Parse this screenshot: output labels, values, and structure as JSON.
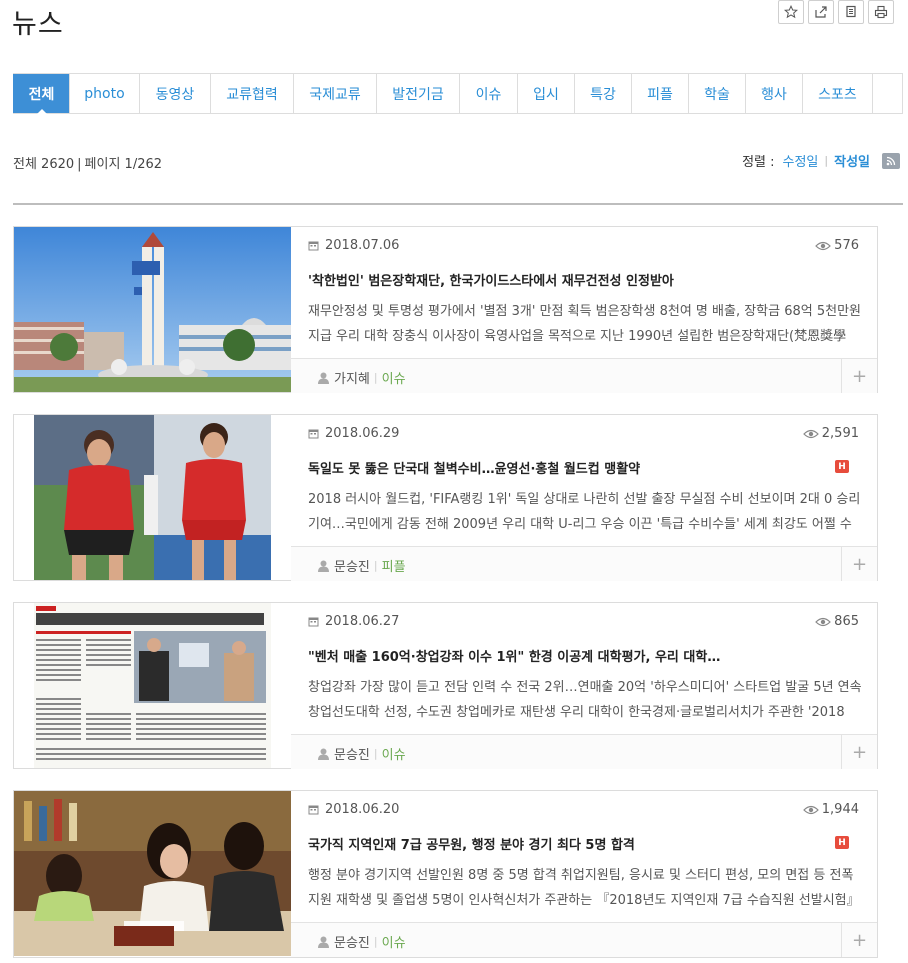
{
  "page": {
    "title": "뉴스"
  },
  "tools": [
    {
      "name": "favorite-icon",
      "label": "☆"
    },
    {
      "name": "share-icon",
      "label": "share"
    },
    {
      "name": "copy-icon",
      "label": "copy"
    },
    {
      "name": "print-icon",
      "label": "print"
    }
  ],
  "tabs": [
    {
      "label": "전체",
      "active": true
    },
    {
      "label": "photo"
    },
    {
      "label": "동영상"
    },
    {
      "label": "교류협력"
    },
    {
      "label": "국제교류"
    },
    {
      "label": "발전기금"
    },
    {
      "label": "이슈"
    },
    {
      "label": "입시"
    },
    {
      "label": "특강"
    },
    {
      "label": "피플"
    },
    {
      "label": "학술"
    },
    {
      "label": "행사"
    },
    {
      "label": "스포츠"
    }
  ],
  "summary": {
    "total": "전체 2620",
    "page": "페이지 1/262"
  },
  "sort": {
    "label": "정렬 :",
    "modified": "수정일",
    "created": "작성일"
  },
  "colors": {
    "accent": "#3d8fd6",
    "link": "#2a8ed6",
    "category": "#6aa84f",
    "hot": "#e74c3c"
  },
  "articles": [
    {
      "date": "2018.07.06",
      "views": "576",
      "hot": false,
      "title": "'착한법인' 범은장학재단, 한국가이드스타에서 재무건전성 인정받아",
      "summary": "재무안정성 및 투명성 평가에서 '별점 3개' 만점 획득 범은장학생 8천여 명 배출, 장학금 68억 5천만원 지급 우리 대학 장충식 이사장이 육영사업을 목적으로 지난 1990년 설립한 범은장학재단(梵恩獎學",
      "author": "가지혜",
      "category": "이슈"
    },
    {
      "date": "2018.06.29",
      "views": "2,591",
      "hot": true,
      "hot_label": "H",
      "title": "독일도 못 뚫은 단국대 철벽수비…윤영선·홍철 월드컵 맹활약",
      "summary": "2018 러시아 월드컵, 'FIFA랭킹 1위' 독일 상대로 나란히 선발 출장 무실점 수비 선보이며 2대 0 승리 기여…국민에게 감동 전해 2009년 우리 대학 U-리그 우승 이끈 '특급 수비수들' 세계 최강도 어쩔 수",
      "author": "문승진",
      "category": "피플"
    },
    {
      "date": "2018.06.27",
      "views": "865",
      "hot": false,
      "title": "\"벤처 매출 160억·창업강좌 이수 1위\" 한경 이공계 대학평가, 우리 대학…",
      "summary": "창업강좌 가장 많이 듣고 전담 인력 수 전국 2위…연매출 20억 '하우스미디어' 스타트업 발굴 5년 연속 창업선도대학 선정, 수도권 창업메카로 재탄생 우리 대학이 한국경제·글로벌리서치가 주관한 '2018",
      "author": "문승진",
      "category": "이슈"
    },
    {
      "date": "2018.06.20",
      "views": "1,944",
      "hot": true,
      "hot_label": "H",
      "title": "국가직 지역인재 7급 공무원, 행정 분야 경기 최다 5명 합격",
      "summary": "행정 분야 경기지역 선발인원 8명 중 5명 합격 취업지원팀, 응시료 및 스터디 편성, 모의 면접 등 전폭 지원 재학생 및 졸업생 5명이 인사혁신처가 주관하는 『2018년도 지역인재 7급 수습직원 선발시험』",
      "author": "문승진",
      "category": "이슈"
    }
  ]
}
